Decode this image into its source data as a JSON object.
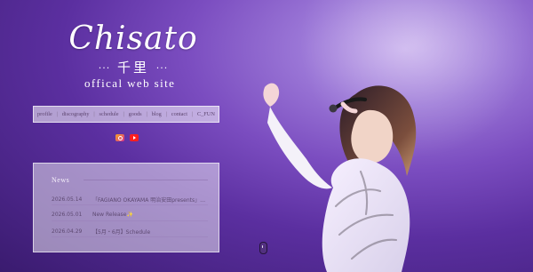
{
  "header": {
    "logo_script": "Chisato",
    "logo_kanji": "千里",
    "logo_dots": "···",
    "site_title": "offical web site"
  },
  "nav": {
    "items": [
      {
        "label": "profile"
      },
      {
        "label": "discography"
      },
      {
        "label": "schedule"
      },
      {
        "label": "goods"
      },
      {
        "label": "blog"
      },
      {
        "label": "contact"
      },
      {
        "label": "C_FUN"
      }
    ],
    "separator": "|"
  },
  "social": {
    "instagram_icon": "instagram-icon",
    "youtube_icon": "youtube-icon"
  },
  "news": {
    "title": "News",
    "items": [
      {
        "date": "2026.05.14",
        "text": "「FAGIANO OKAYAMA 明治安田presents」Liv…"
      },
      {
        "date": "2026.05.01",
        "text": "New Release✨"
      },
      {
        "date": "2026.04.29",
        "text": "【5月・6月】Schedule"
      }
    ]
  },
  "colors": {
    "background_primary": "#7b4dc0",
    "background_dark": "#3a1b6f",
    "nav_text": "#5d456f",
    "news_text": "#5e4a72"
  }
}
